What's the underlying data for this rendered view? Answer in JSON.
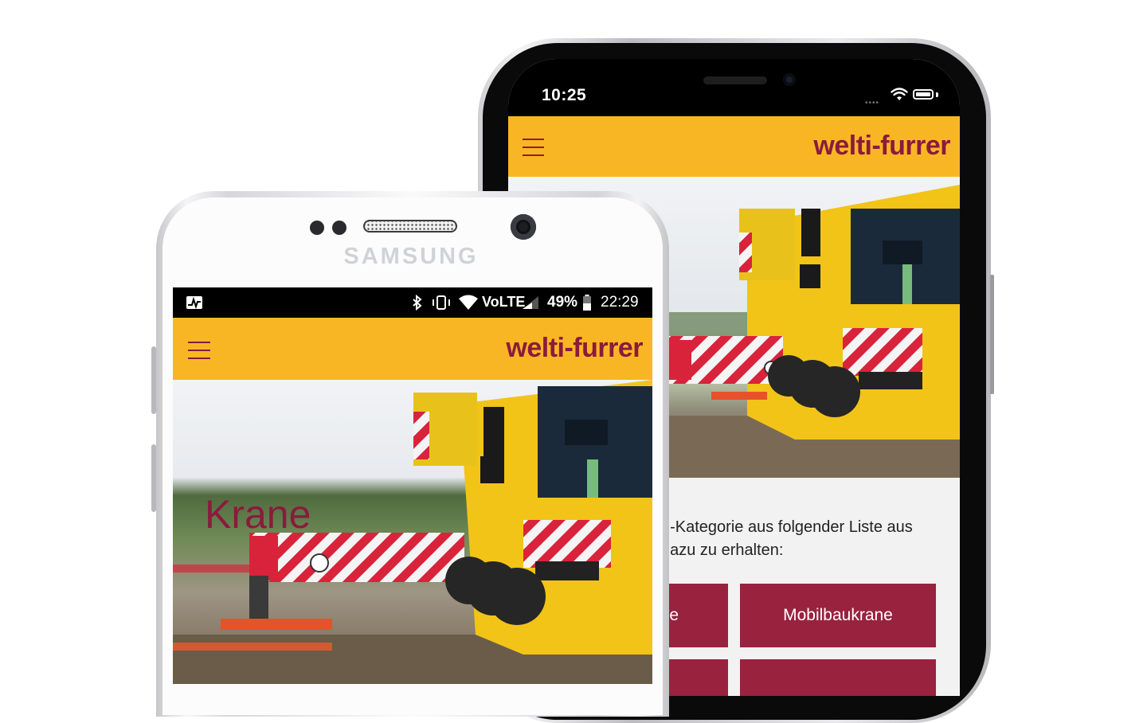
{
  "iphone": {
    "status": {
      "time": "10:25",
      "signal_dots": "••••"
    },
    "header": {
      "brand": "welti-furrer"
    },
    "content": {
      "intro_line1": "n-Kategorie aus folgender Liste aus",
      "intro_line2": "dazu zu erhalten:",
      "buttons": [
        {
          "label": "e"
        },
        {
          "label": "Mobilbaukrane"
        },
        {
          "label": ""
        },
        {
          "label": ""
        }
      ]
    }
  },
  "samsung": {
    "brand_logo": "SAMSUNG",
    "status": {
      "network": "VoLTE",
      "battery": "49%",
      "time": "22:29"
    },
    "header": {
      "brand": "welti-furrer"
    },
    "hero": {
      "title": "Krane"
    }
  },
  "colors": {
    "brand_yellow": "#f9b624",
    "brand_red": "#8a1b3d",
    "button_red": "#99223f"
  },
  "icons": [
    "menu-icon",
    "bluetooth-icon",
    "vibrate-icon",
    "wifi-icon",
    "signal-icon",
    "battery-icon",
    "activity-icon"
  ]
}
